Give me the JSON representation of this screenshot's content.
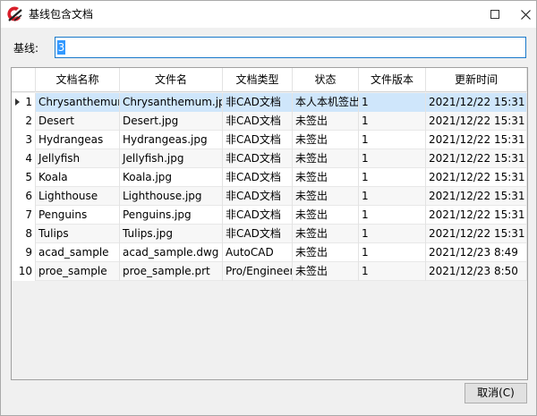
{
  "window": {
    "title": "基线包含文档"
  },
  "baseline": {
    "label": "基线:",
    "value": "3"
  },
  "table": {
    "columns": [
      "",
      "文档名称",
      "文件名",
      "文档类型",
      "状态",
      "文件版本",
      "更新时间"
    ],
    "rows": [
      {
        "num": "1",
        "name": "Chrysanthemum",
        "file": "Chrysanthemum.jpg",
        "type": "非CAD文档",
        "status": "本人本机签出",
        "version": "1",
        "updated": "2021/12/22 15:31"
      },
      {
        "num": "2",
        "name": "Desert",
        "file": "Desert.jpg",
        "type": "非CAD文档",
        "status": "未签出",
        "version": "1",
        "updated": "2021/12/22 15:31"
      },
      {
        "num": "3",
        "name": "Hydrangeas",
        "file": "Hydrangeas.jpg",
        "type": "非CAD文档",
        "status": "未签出",
        "version": "1",
        "updated": "2021/12/22 15:31"
      },
      {
        "num": "4",
        "name": "Jellyfish",
        "file": "Jellyfish.jpg",
        "type": "非CAD文档",
        "status": "未签出",
        "version": "1",
        "updated": "2021/12/22 15:31"
      },
      {
        "num": "5",
        "name": "Koala",
        "file": "Koala.jpg",
        "type": "非CAD文档",
        "status": "未签出",
        "version": "1",
        "updated": "2021/12/22 15:31"
      },
      {
        "num": "6",
        "name": "Lighthouse",
        "file": "Lighthouse.jpg",
        "type": "非CAD文档",
        "status": "未签出",
        "version": "1",
        "updated": "2021/12/22 15:31"
      },
      {
        "num": "7",
        "name": "Penguins",
        "file": "Penguins.jpg",
        "type": "非CAD文档",
        "status": "未签出",
        "version": "1",
        "updated": "2021/12/22 15:31"
      },
      {
        "num": "8",
        "name": "Tulips",
        "file": "Tulips.jpg",
        "type": "非CAD文档",
        "status": "未签出",
        "version": "1",
        "updated": "2021/12/22 15:31"
      },
      {
        "num": "9",
        "name": "acad_sample",
        "file": "acad_sample.dwg",
        "type": "AutoCAD",
        "status": "未签出",
        "version": "1",
        "updated": "2021/12/23 8:49"
      },
      {
        "num": "10",
        "name": "proe_sample",
        "file": "proe_sample.prt",
        "type": "Pro/Engineer",
        "status": "未签出",
        "version": "1",
        "updated": "2021/12/23 8:50"
      }
    ]
  },
  "buttons": {
    "cancel": "取消(C)"
  },
  "icons": {
    "app": "app-logo-icon",
    "maximize": "maximize-icon",
    "close": "close-icon",
    "current_row": "row-pointer-icon"
  },
  "colors": {
    "selection": "#cfe6fb",
    "input_border": "#1979ca",
    "app_red": "#d81e2a"
  }
}
